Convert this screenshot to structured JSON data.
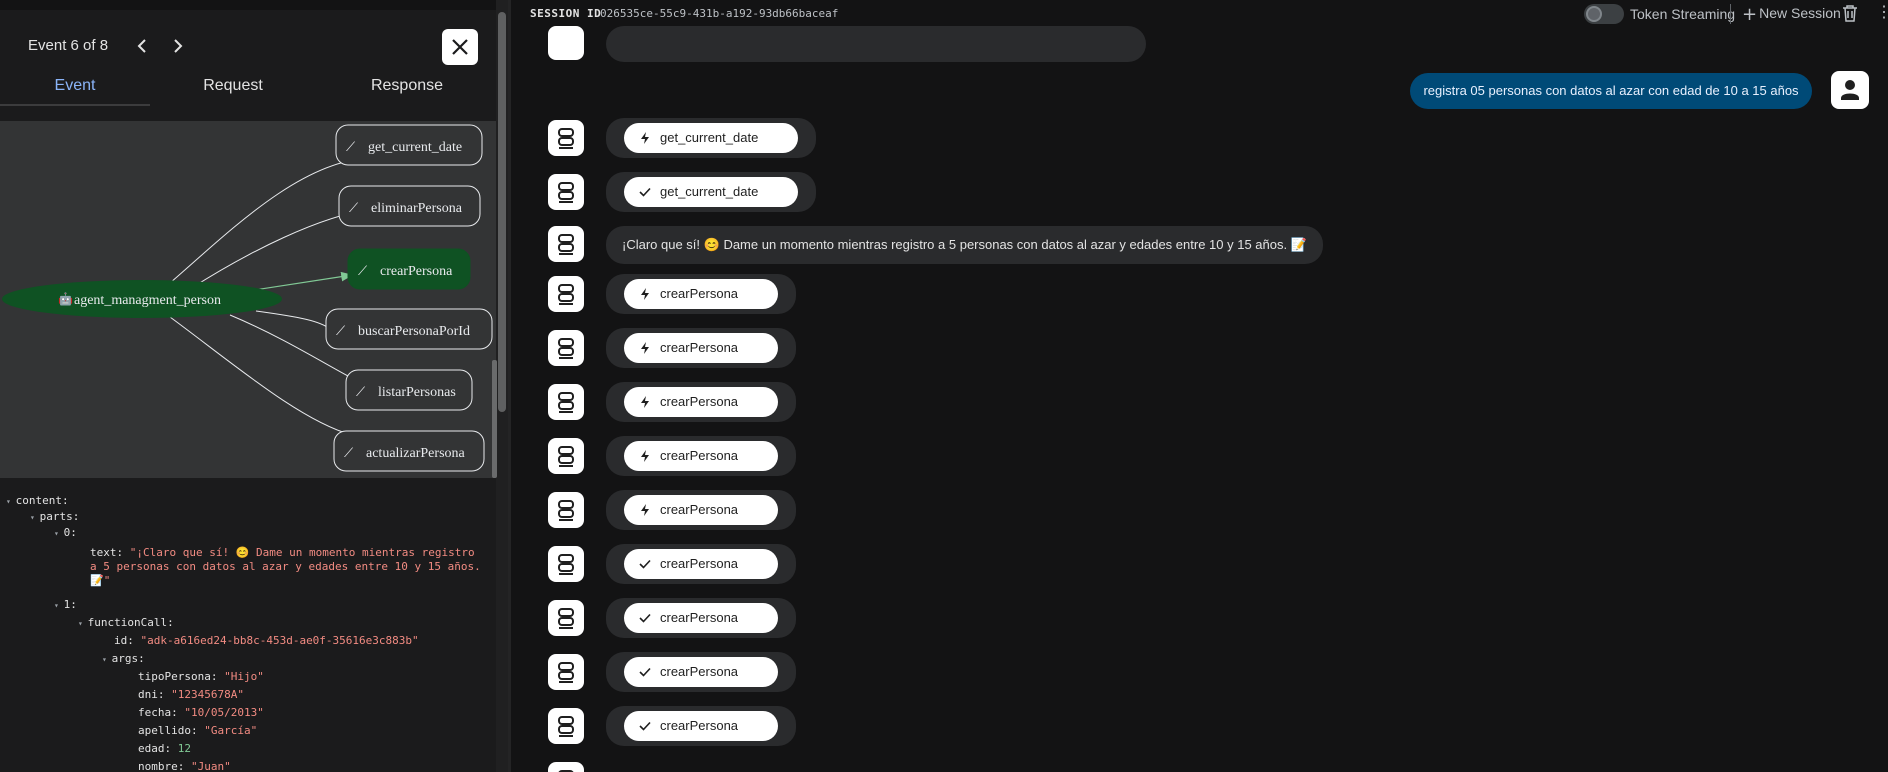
{
  "event_panel": {
    "event_counter": "Event 6 of 8",
    "tabs": [
      "Event",
      "Request",
      "Response"
    ],
    "graph": {
      "agent": "agent_managment_person",
      "tools": [
        "get_current_date",
        "eliminarPersona",
        "crearPersona",
        "buscarPersonaPorId",
        "listarPersonas",
        "actualizarPersona"
      ],
      "active_tool": "crearPersona"
    },
    "json": {
      "content": "content:",
      "parts": "parts:",
      "idx0": "0:",
      "text_key": "text:",
      "text_line1": "\"¡Claro que sí! 😊 Dame un momento mientras registro",
      "text_line2": "a 5 personas con datos al azar y edades entre 10 y 15 años.",
      "text_line3": "📝\"",
      "idx1": "1:",
      "functionCall": "functionCall:",
      "id_key": "id:",
      "id_val": "\"adk-a616ed24-bb8c-453d-ae0f-35616e3c883b\"",
      "args": "args:",
      "tipo_key": "tipoPersona:",
      "tipo_val": "\"Hijo\"",
      "dni_key": "dni:",
      "dni_val": "\"12345678A\"",
      "fecha_key": "fecha:",
      "fecha_val": "\"10/05/2013\"",
      "apellido_key": "apellido:",
      "apellido_val": "\"García\"",
      "edad_key": "edad:",
      "edad_val": "12",
      "nombre_key": "nombre:",
      "nombre_val": "\"Juan\""
    }
  },
  "session": {
    "label": "SESSION ID",
    "id": "026535ce-55c9-431b-a192-93db66baceaf",
    "token_streaming": "Token Streaming",
    "new_session": "New Session"
  },
  "chat": {
    "user_message": "registra 05 personas con datos al azar con edad de 10 a 15 años",
    "assistant_text": "¡Claro que sí! 😊 Dame un momento mientras registro a 5 personas con datos al azar y edades entre 10 y 15 años. 📝",
    "calls": [
      {
        "kind": "call",
        "label": "get_current_date"
      },
      {
        "kind": "result",
        "label": "get_current_date"
      },
      {
        "kind": "call",
        "label": "crearPersona"
      },
      {
        "kind": "call",
        "label": "crearPersona"
      },
      {
        "kind": "call",
        "label": "crearPersona"
      },
      {
        "kind": "call",
        "label": "crearPersona"
      },
      {
        "kind": "call",
        "label": "crearPersona"
      },
      {
        "kind": "result",
        "label": "crearPersona"
      },
      {
        "kind": "result",
        "label": "crearPersona"
      },
      {
        "kind": "result",
        "label": "crearPersona"
      },
      {
        "kind": "result",
        "label": "crearPersona"
      }
    ]
  }
}
